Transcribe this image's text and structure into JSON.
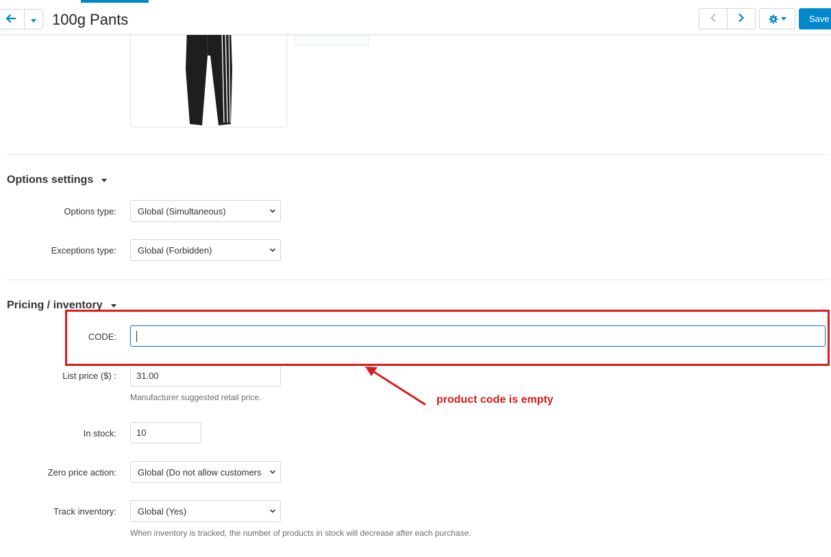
{
  "header": {
    "title": "100g Pants",
    "save_label": "Save",
    "accent_color": "#0388cc"
  },
  "options_section": {
    "title": "Options settings",
    "fields": [
      {
        "label": "Options type:",
        "value": "Global (Simultaneous)"
      },
      {
        "label": "Exceptions type:",
        "value": "Global (Forbidden)"
      }
    ]
  },
  "pricing_section": {
    "title": "Pricing / inventory",
    "code": {
      "label": "CODE:",
      "value": ""
    },
    "list_price": {
      "label": "List price ($) :",
      "value": "31.00",
      "help": "Manufacturer suggested retail price."
    },
    "in_stock": {
      "label": "In stock:",
      "value": "10"
    },
    "zero_price_action": {
      "label": "Zero price action:",
      "value": "Global (Do not allow customers"
    },
    "track_inventory": {
      "label": "Track inventory:",
      "value": "Global (Yes)",
      "help": "When inventory is tracked, the number of products in stock will decrease after each purchase."
    }
  },
  "annotation": {
    "text": "product code is empty",
    "color": "#e0181c"
  },
  "icons": {
    "back": "arrow-left-icon",
    "dropdown": "caret-down-icon",
    "prev": "chevron-left-icon",
    "next": "chevron-right-icon",
    "settings": "gear-icon"
  }
}
